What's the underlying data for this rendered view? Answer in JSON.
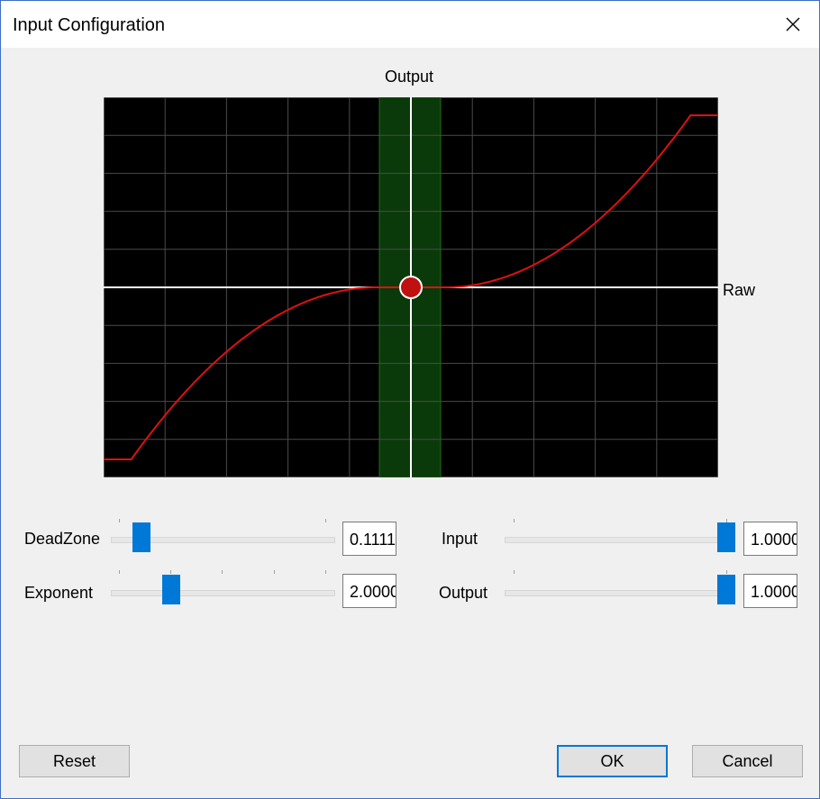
{
  "window": {
    "title": "Input Configuration"
  },
  "chart": {
    "output_label": "Output",
    "raw_label": "Raw"
  },
  "sliders": {
    "deadzone": {
      "label": "DeadZone",
      "value": "0.1111",
      "level": 0.1111
    },
    "exponent": {
      "label": "Exponent",
      "value": "2.0000",
      "level": 0.25
    },
    "input": {
      "label": "Input",
      "value": "1.0000",
      "level": 1.0
    },
    "output": {
      "label": "Output",
      "value": "1.0000",
      "level": 1.0
    }
  },
  "buttons": {
    "reset": "Reset",
    "ok": "OK",
    "cancel": "Cancel"
  },
  "colors": {
    "plot_background": "#000000",
    "curve": "#e01010",
    "deadzone_band": "#0a3a0a",
    "slider_thumb": "#0078d7",
    "window_border": "#3e6fc4"
  }
}
